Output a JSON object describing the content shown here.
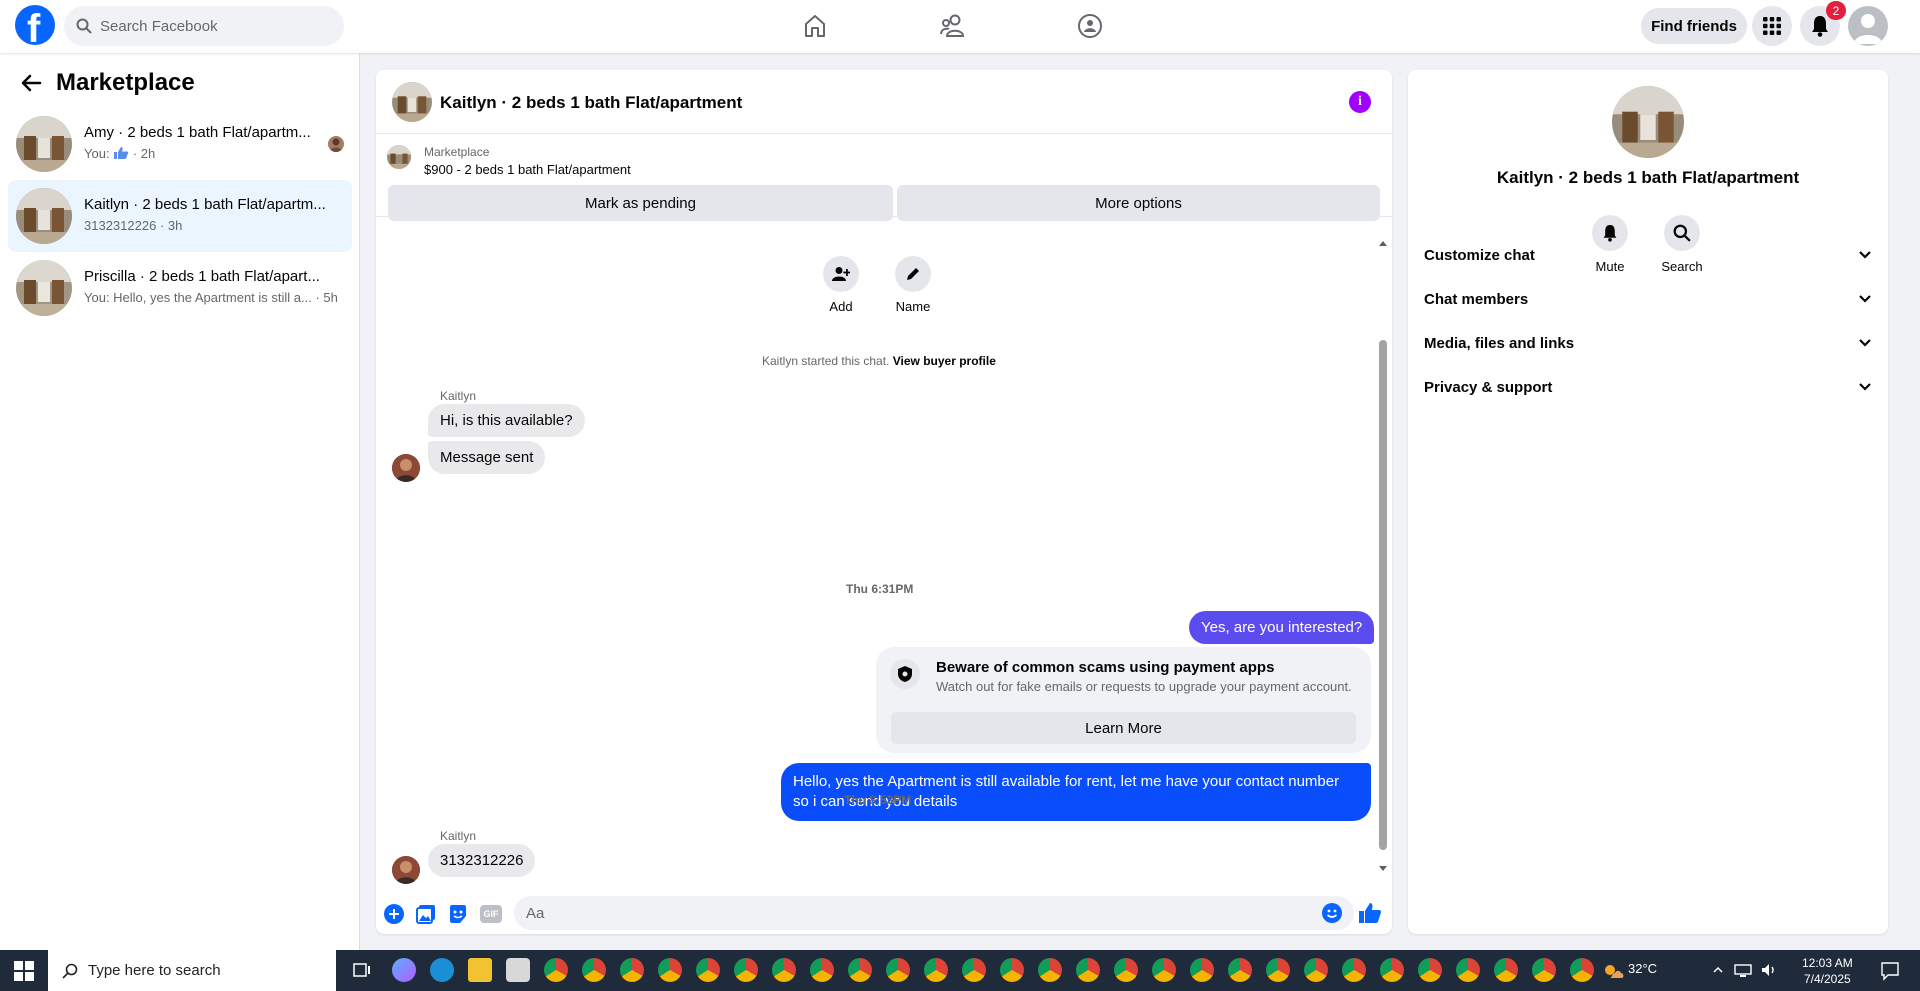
{
  "colors": {
    "brand": "#0866ff",
    "outgoing_bubble": "#0a4dfc",
    "info_accent": "#a100ff",
    "notification_badge": "#e41e3f"
  },
  "topbar": {
    "logo_letter": "f",
    "search_placeholder": "Search Facebook",
    "find_friends_label": "Find friends",
    "notification_count": "2",
    "icons": [
      "home-icon",
      "friends-icon",
      "groups-icon",
      "menu-grid-icon",
      "bell-icon",
      "avatar"
    ]
  },
  "sidebar": {
    "title": "Marketplace",
    "conversations": [
      {
        "title": "Amy · 2 beds 1 bath Flat/apartm...",
        "preview": "You:",
        "preview_icon": "thumbs-up-icon",
        "time": "· 2h"
      },
      {
        "title": "Kaitlyn · 2 beds 1 bath Flat/apartm...",
        "preview": "3132312226",
        "time": "· 3h"
      },
      {
        "title": "Priscilla · 2 beds 1 bath Flat/apart...",
        "preview": "You: Hello, yes the Apartment is still a...",
        "time": "· 5h"
      }
    ]
  },
  "chat": {
    "title": "Kaitlyn · 2 beds 1 bath Flat/apartment",
    "listing": {
      "category": "Marketplace",
      "price_title": "$900 - 2 beds 1 bath Flat/apartment",
      "mark_pending_label": "Mark as pending",
      "more_options_label": "More options"
    },
    "actions": {
      "add_label": "Add",
      "name_label": "Name"
    },
    "started_text": "Kaitlyn started this chat.",
    "view_profile_label": "View buyer profile",
    "messages": {
      "sender1": "Kaitlyn",
      "m1": "Hi, is this available?",
      "m2": "Message sent",
      "time1": "Thu 6:31PM",
      "m3": "Yes, are you interested?",
      "scam_title": "Beware of common scams using payment apps",
      "scam_sub": "Watch out for fake emails or requests to upgrade your payment account.",
      "learn_more": "Learn More",
      "m4": "Hello, yes the Apartment is still available for rent, let me have your contact number so i can send you details",
      "time2": "Thu 8:53PM",
      "sender2": "Kaitlyn",
      "m5": "3132312226"
    },
    "composer": {
      "placeholder": "Aa",
      "gif_label": "GIF"
    }
  },
  "details": {
    "title": "Kaitlyn · 2 beds 1 bath Flat/apartment",
    "mute_label": "Mute",
    "search_label": "Search",
    "sections": [
      "Customize chat",
      "Chat members",
      "Media, files and links",
      "Privacy & support"
    ]
  },
  "taskbar": {
    "search_placeholder": "Type here to search",
    "weather": "32°C",
    "time": "12:03 AM",
    "date": "7/4/2025"
  }
}
